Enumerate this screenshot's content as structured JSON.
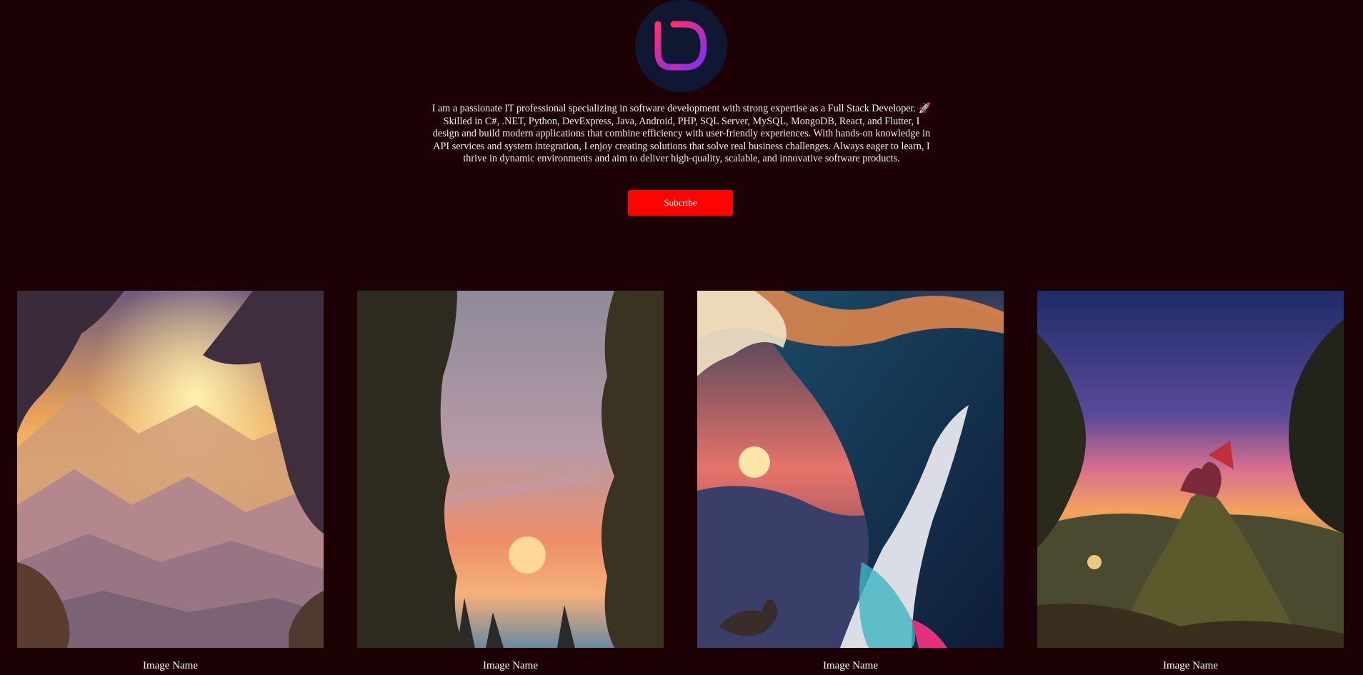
{
  "profile": {
    "logo_name": "ud-monogram-logo",
    "bio": "I am a passionate IT professional specializing in software development with strong expertise as a Full Stack Developer. 🚀 Skilled in C#, .NET, Python, DevExpress, Java, Android, PHP, SQL Server, MySQL, MongoDB, React, and Flutter, I design and build modern applications that combine efficiency with user-friendly experiences. With hands-on knowledge in API services and system integration, I enjoy creating solutions that solve real business challenges. Always eager to learn, I thrive in dynamic environments and aim to deliver high-quality, scalable, and innovative software products.",
    "subscribe_label": "Subcribe"
  },
  "gallery": {
    "items": [
      {
        "caption": "Image Name",
        "scene": "mountain-sunset"
      },
      {
        "caption": "Image Name",
        "scene": "forest-sunset"
      },
      {
        "caption": "Image Name",
        "scene": "ocean-wave"
      },
      {
        "caption": "Image Name",
        "scene": "dragon-on-rock"
      }
    ]
  },
  "colors": {
    "background": "#1c0205",
    "button": "#ff0202",
    "logo_bg": "#0f1733",
    "logo_gradient_start": "#ff2d6f",
    "logo_gradient_end": "#7b2ff7"
  }
}
